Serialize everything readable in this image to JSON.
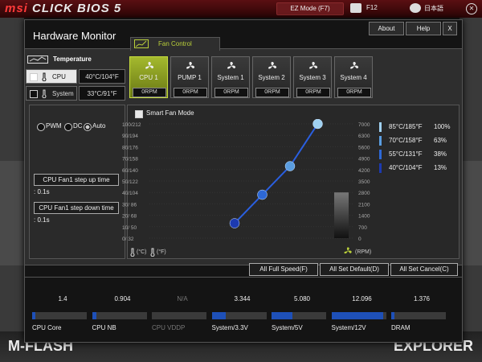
{
  "app": {
    "brand_msi": "msi",
    "brand_rest": "CLICK BIOS 5",
    "ez_mode": "EZ Mode (F7)",
    "f12": "F12",
    "language": "日本語"
  },
  "background": {
    "mflash": "M-FLASH",
    "explorer": "EXPLORER"
  },
  "window": {
    "title": "Hardware Monitor",
    "buttons": {
      "about": "About",
      "help": "Help",
      "close": "X"
    }
  },
  "temperature": {
    "tab_label": "Temperature",
    "sensors": [
      {
        "name": "CPU",
        "value": "40°C/104°F",
        "checked": true
      },
      {
        "name": "System",
        "value": "33°C/91°F",
        "checked": false
      }
    ]
  },
  "fan_control": {
    "tab_label": "Fan Control",
    "fans": [
      {
        "name": "CPU 1",
        "rpm": "0RPM"
      },
      {
        "name": "PUMP 1",
        "rpm": "0RPM"
      },
      {
        "name": "System 1",
        "rpm": "0RPM"
      },
      {
        "name": "System 2",
        "rpm": "0RPM"
      },
      {
        "name": "System 3",
        "rpm": "0RPM"
      },
      {
        "name": "System 4",
        "rpm": "0RPM"
      }
    ],
    "modes": {
      "pwm": "PWM",
      "dc": "DC",
      "auto": "Auto",
      "selected": "Auto"
    },
    "step_up_label": "CPU Fan1 step up time",
    "step_up_value": ": 0.1s",
    "step_down_label": "CPU Fan1 step down time",
    "step_down_value": ": 0.1s",
    "smart_fan_label": "Smart Fan Mode",
    "unit_temp_c": "(°C)",
    "unit_temp_f": "(°F)",
    "unit_rpm": "(RPM)"
  },
  "chart_data": {
    "type": "line",
    "y_left_ticks": [
      "100/212",
      "90/194",
      "80/176",
      "70/158",
      "60/140",
      "50/122",
      "40/104",
      "30/ 86",
      "20/ 68",
      "10/ 50",
      "0/ 32"
    ],
    "y_right_ticks": [
      "7000",
      "6300",
      "5600",
      "4900",
      "4200",
      "3500",
      "2800",
      "2100",
      "1400",
      "700",
      "0"
    ],
    "points": [
      {
        "temp_c": 40,
        "pct": 13
      },
      {
        "temp_c": 55,
        "pct": 38
      },
      {
        "temp_c": 70,
        "pct": 63
      },
      {
        "temp_c": 85,
        "pct": 100
      }
    ],
    "current_rpm_bar": 2800,
    "ylim_left": [
      0,
      100
    ],
    "ylim_right": [
      0,
      7000
    ],
    "legend": [
      {
        "temp": "85°C/185°F",
        "pct": "100%",
        "color": "#9fd0f0"
      },
      {
        "temp": "70°C/158°F",
        "pct": "63%",
        "color": "#5a9de0"
      },
      {
        "temp": "55°C/131°F",
        "pct": "38%",
        "color": "#2d68d6"
      },
      {
        "temp": "40°C/104°F",
        "pct": "13%",
        "color": "#1c3ab0"
      }
    ]
  },
  "actions": {
    "full_speed": "All Full Speed(F)",
    "set_default": "All Set Default(D)",
    "set_cancel": "All Set Cancel(C)"
  },
  "voltages": [
    {
      "label": "CPU Core",
      "value": "1.4",
      "level": 0.05,
      "dim": false
    },
    {
      "label": "CPU NB",
      "value": "0.904",
      "level": 0.08,
      "dim": false
    },
    {
      "label": "CPU VDDP",
      "value": "N/A",
      "level": 0,
      "dim": true
    },
    {
      "label": "System/3.3V",
      "value": "3.344",
      "level": 0.25,
      "dim": false
    },
    {
      "label": "System/5V",
      "value": "5.080",
      "level": 0.38,
      "dim": false
    },
    {
      "label": "System/12V",
      "value": "12.096",
      "level": 0.95,
      "dim": false
    },
    {
      "label": "DRAM",
      "value": "1.376",
      "level": 0.06,
      "dim": false
    }
  ]
}
